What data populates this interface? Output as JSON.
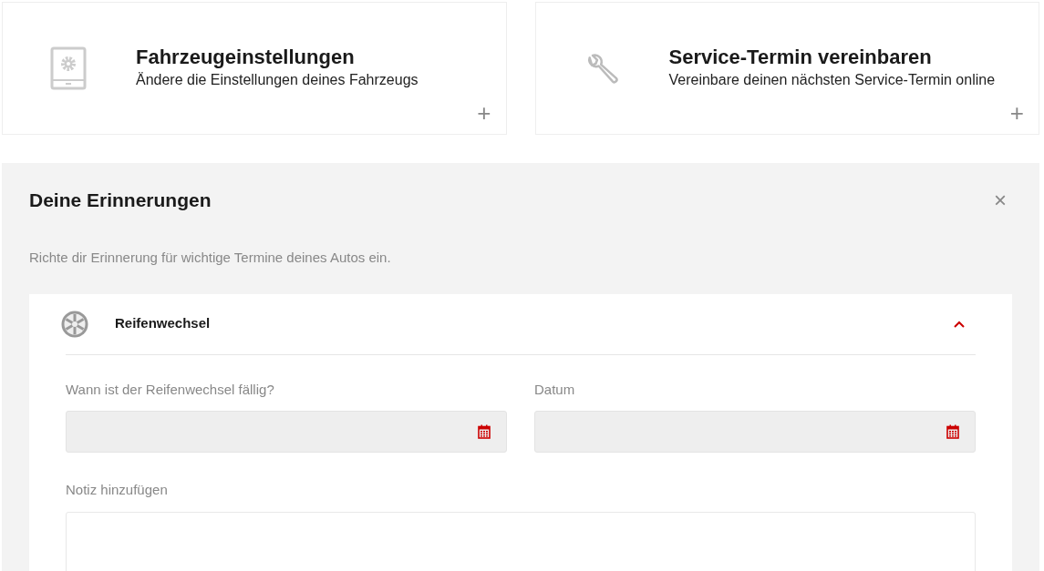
{
  "tiles": [
    {
      "kind": "settings",
      "title": "Fahrzeugeinstellungen",
      "subtitle": "Ändere die Einstellungen deines Fahrzeugs",
      "action": "+"
    },
    {
      "kind": "service",
      "title": "Service-Termin vereinbaren",
      "subtitle": "Vereinbare deinen nächsten Service-Termin online",
      "action": "+"
    }
  ],
  "reminders": {
    "title": "Deine Erinnerungen",
    "close": "×",
    "description": "Richte dir Erinnerung für wichtige Termine deines Autos ein.",
    "sections": [
      {
        "title": "Reifenwechsel",
        "expanded": true,
        "fields": [
          {
            "kind": "date",
            "label": "Wann ist der Reifenwechsel fällig?"
          },
          {
            "kind": "date",
            "label": "Datum"
          },
          {
            "kind": "note",
            "label": "Notiz hinzufügen"
          }
        ]
      }
    ]
  }
}
